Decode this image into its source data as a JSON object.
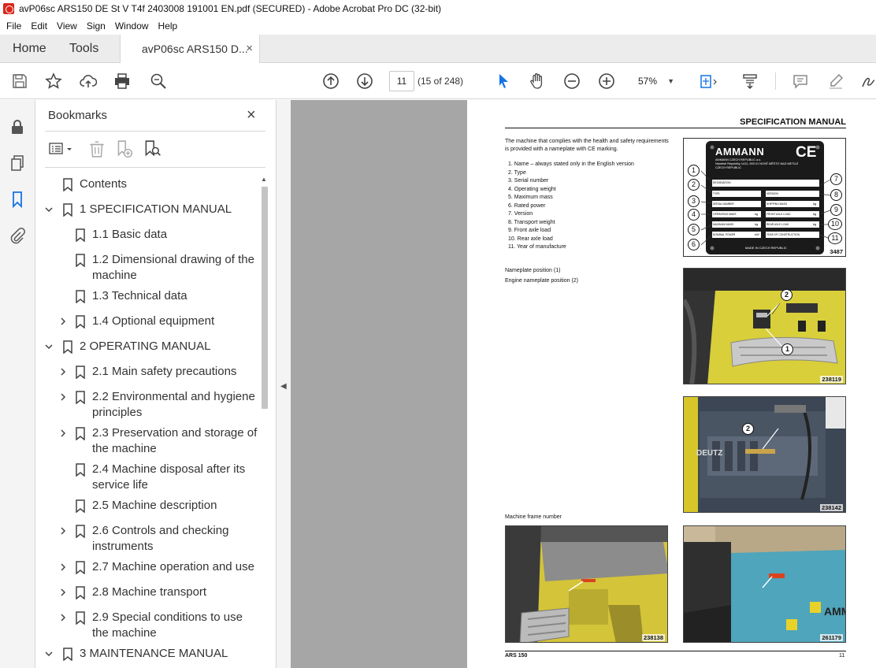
{
  "window": {
    "title": "avP06sc ARS150 DE St V T4f 2403008 191001 EN.pdf (SECURED) - Adobe Acrobat Pro DC (32-bit)"
  },
  "menu": {
    "items": [
      "File",
      "Edit",
      "View",
      "Sign",
      "Window",
      "Help"
    ]
  },
  "tabs": {
    "home": "Home",
    "tools": "Tools",
    "document": "avP06sc ARS150 D...",
    "close": "×"
  },
  "toolbar": {
    "page_number": "11",
    "page_count": "(15 of 248)",
    "zoom": "57%"
  },
  "bookmarks": {
    "title": "Bookmarks",
    "close": "×",
    "items": [
      {
        "label": "Contents",
        "level": 0,
        "caret": "none"
      },
      {
        "label": "1 SPECIFICATION MANUAL",
        "level": 0,
        "caret": "down"
      },
      {
        "label": "1.1 Basic data",
        "level": 1,
        "caret": "none"
      },
      {
        "label": "1.2 Dimensional drawing of the machine",
        "level": 1,
        "caret": "none"
      },
      {
        "label": "1.3 Technical data",
        "level": 1,
        "caret": "none"
      },
      {
        "label": "1.4 Optional equipment",
        "level": 1,
        "caret": "right"
      },
      {
        "label": "2 OPERATING MANUAL",
        "level": 0,
        "caret": "down"
      },
      {
        "label": "2.1 Main safety precautions",
        "level": 1,
        "caret": "right"
      },
      {
        "label": "2.2 Environmental and hygiene principles",
        "level": 1,
        "caret": "right"
      },
      {
        "label": "2.3 Preservation and storage of the machine",
        "level": 1,
        "caret": "right"
      },
      {
        "label": "2.4 Machine disposal after its service life",
        "level": 1,
        "caret": "none"
      },
      {
        "label": "2.5 Machine description",
        "level": 1,
        "caret": "none"
      },
      {
        "label": "2.6 Controls and checking instruments",
        "level": 1,
        "caret": "right"
      },
      {
        "label": "2.7 Machine operation and use",
        "level": 1,
        "caret": "right"
      },
      {
        "label": "2.8 Machine transport",
        "level": 1,
        "caret": "right"
      },
      {
        "label": "2.9 Special conditions to use the machine",
        "level": 1,
        "caret": "right"
      },
      {
        "label": "3 MAINTENANCE MANUAL",
        "level": 0,
        "caret": "down"
      }
    ]
  },
  "document": {
    "header": "SPECIFICATION MANUAL",
    "intro": "The machine that complies with the health and safety requirements is provided with a nameplate with CE marking.",
    "list": [
      "1.  Name – always stated only in the English version",
      "2.  Type",
      "3.  Serial number",
      "4.  Operating weight",
      "5.  Maximum mass",
      "6.  Rated power",
      "7.  Version",
      "8.  Transport weight",
      "9.  Front axle load",
      "10.  Rear axle load",
      "11.  Year of manufacture"
    ],
    "nameplate": {
      "brand": "AMMANN",
      "ce": "CE",
      "company": "AMMANN CZECH REPUBLIC a.s.",
      "address1": "Náměstí Republiky 1412, 593 01 NOVÉ MĚSTO NAD METUJÍ",
      "country": "CZECH REPUBLIC",
      "fields_left": [
        "DESIGNATION",
        "TYPE",
        "SERIAL NUMBER",
        "OPERATING MASS",
        "MAXIMUM MASS",
        "NOMINAL POWER"
      ],
      "fields_right": [
        "VERSION",
        "SHIPPING MASS",
        "FRONT AXLE LOAD",
        "REAR AXLE LOAD",
        "YEAR OF CONSTRUCTION"
      ],
      "units_left": [
        "",
        "",
        "",
        "kg",
        "kg",
        "kW"
      ],
      "units_right": [
        "",
        "kg",
        "kg",
        "kg",
        ""
      ],
      "made_in": "MADE IN CZECH REPUBLIC",
      "number": "3487",
      "callouts": [
        "1",
        "2",
        "3",
        "4",
        "5",
        "6",
        "7",
        "8",
        "9",
        "10",
        "11"
      ]
    },
    "caption1": "Nameplate position (1)",
    "caption2": "Engine nameplate position (2)",
    "caption3": "Machine frame number",
    "photos": [
      {
        "number": "238119",
        "callouts": [
          "2",
          "1"
        ]
      },
      {
        "number": "238142",
        "callouts": [
          "2"
        ],
        "engine_text": "DEUTZ"
      },
      {
        "number": "238138"
      },
      {
        "number": "261179",
        "logo": "AMM"
      }
    ],
    "footer_left": "ARS 150",
    "footer_right": "11"
  },
  "colors": {
    "canvas_gray": "#a6a6a6",
    "acrobat_red": "#d9261c",
    "active_icon_blue": "#1473e6"
  }
}
